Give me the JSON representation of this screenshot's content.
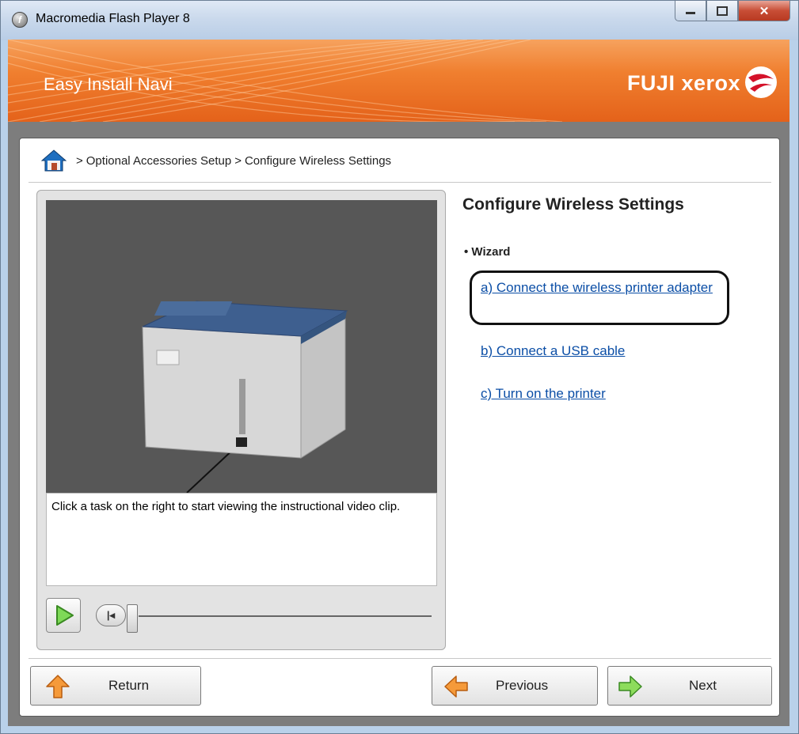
{
  "window": {
    "title": "Macromedia Flash Player 8",
    "app_icon": "flash-player-icon",
    "controls": [
      "minimize-icon",
      "maximize-icon",
      "close-icon"
    ]
  },
  "header": {
    "title": "Easy Install Navi",
    "brand": "FUJI xerox",
    "brand_logo_icon": "fuji-xerox-sphere-logo",
    "accent_color": "#f07f2f"
  },
  "breadcrumb": {
    "home_icon": "home-icon",
    "items": [
      "Optional Accessories Setup",
      "Configure Wireless Settings"
    ],
    "separator": ">"
  },
  "video": {
    "caption": "Click a task on the right to start viewing the instructional video clip.",
    "play_icon": "play-icon",
    "rewind_icon": "rewind-to-start-icon",
    "progress": 0.0
  },
  "right": {
    "title": "Configure Wireless Settings",
    "section_label": "• Wizard",
    "links": [
      {
        "label": "a) Connect the wireless printer adapter",
        "highlighted": true
      },
      {
        "label": "b) Connect a USB cable"
      },
      {
        "label": "c) Turn on the printer"
      }
    ],
    "link_color": "#0b4ea6"
  },
  "buttons": {
    "return_label": "Return",
    "previous_label": "Previous",
    "next_label": "Next",
    "return_icon": "return-up-arrow-icon",
    "previous_icon": "left-arrow-icon",
    "next_icon": "right-arrow-icon"
  }
}
